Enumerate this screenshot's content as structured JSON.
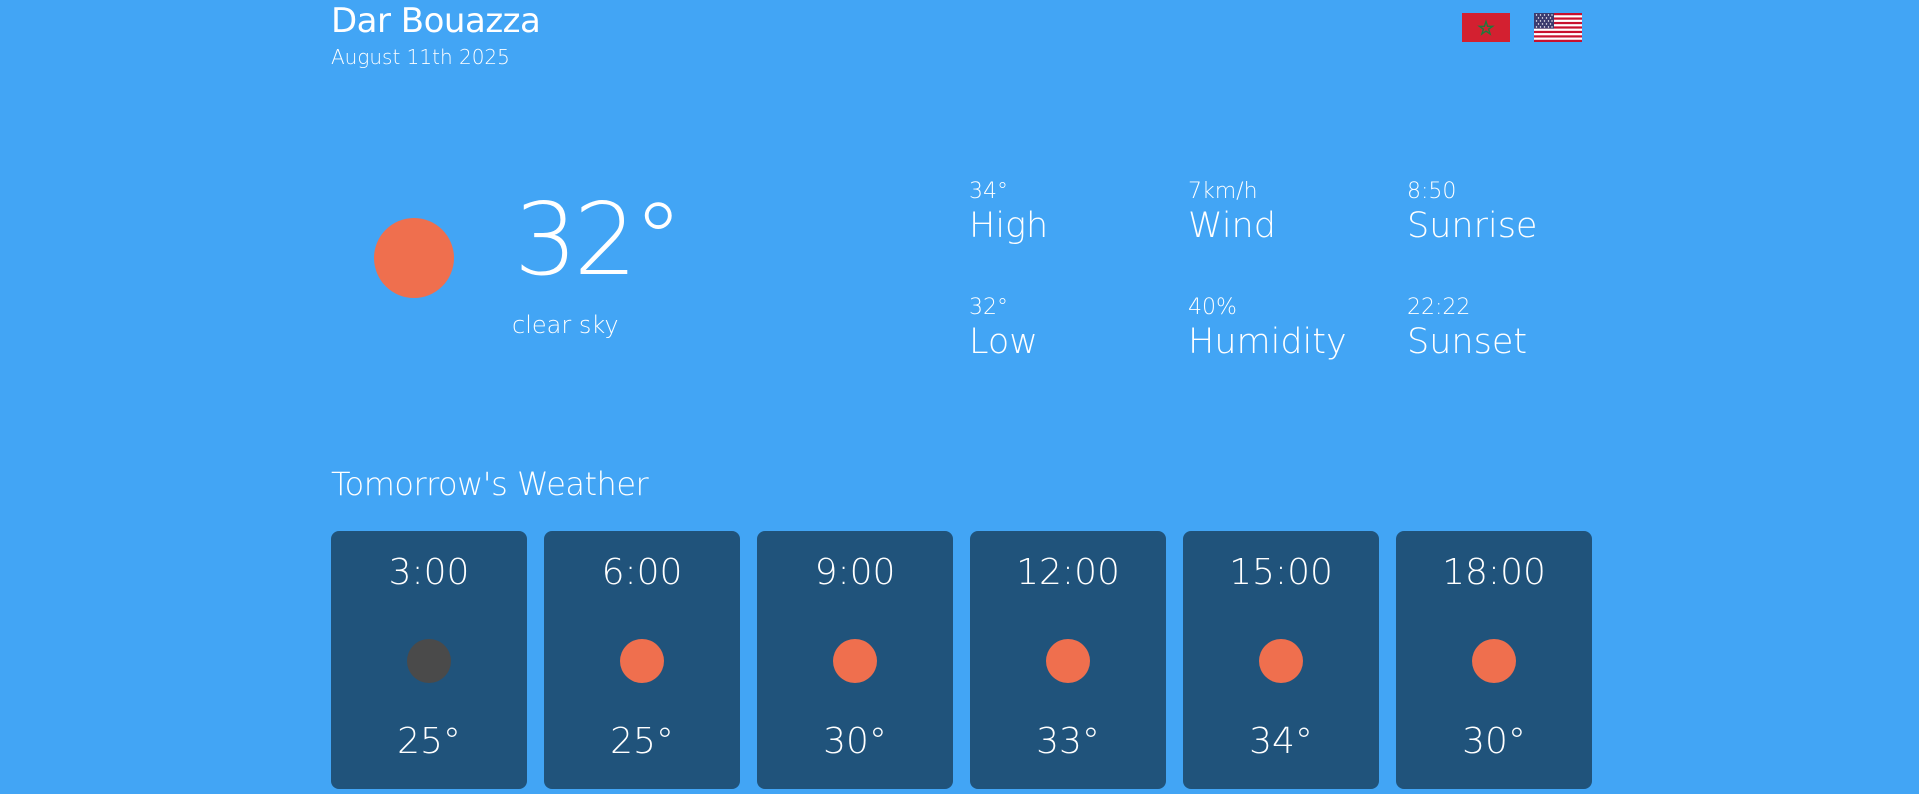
{
  "header": {
    "location": "Dar Bouazza",
    "date": "August 11th 2025",
    "languages": [
      {
        "icon": "morocco-flag-icon"
      },
      {
        "icon": "usa-flag-icon"
      }
    ]
  },
  "current": {
    "icon": "sun-icon",
    "temperature": "32°",
    "description": "clear sky",
    "stats": [
      {
        "value": "34°",
        "label": "High"
      },
      {
        "value": "7km/h",
        "label": "Wind"
      },
      {
        "value": "8:50",
        "label": "Sunrise"
      },
      {
        "value": "32°",
        "label": "Low"
      },
      {
        "value": "40%",
        "label": "Humidity"
      },
      {
        "value": "22:22",
        "label": "Sunset"
      }
    ]
  },
  "tomorrow": {
    "title": "Tomorrow's Weather",
    "forecast": [
      {
        "time": "3:00",
        "icon": "moon-icon",
        "temp": "25°"
      },
      {
        "time": "6:00",
        "icon": "sun-icon",
        "temp": "25°"
      },
      {
        "time": "9:00",
        "icon": "sun-icon",
        "temp": "30°"
      },
      {
        "time": "12:00",
        "icon": "sun-icon",
        "temp": "33°"
      },
      {
        "time": "15:00",
        "icon": "sun-icon",
        "temp": "34°"
      },
      {
        "time": "18:00",
        "icon": "sun-icon",
        "temp": "30°"
      }
    ]
  },
  "colors": {
    "background": "#42a5f5",
    "card": "#20537b",
    "sun": "#ef6f4e",
    "moon": "#4a4a4a"
  }
}
